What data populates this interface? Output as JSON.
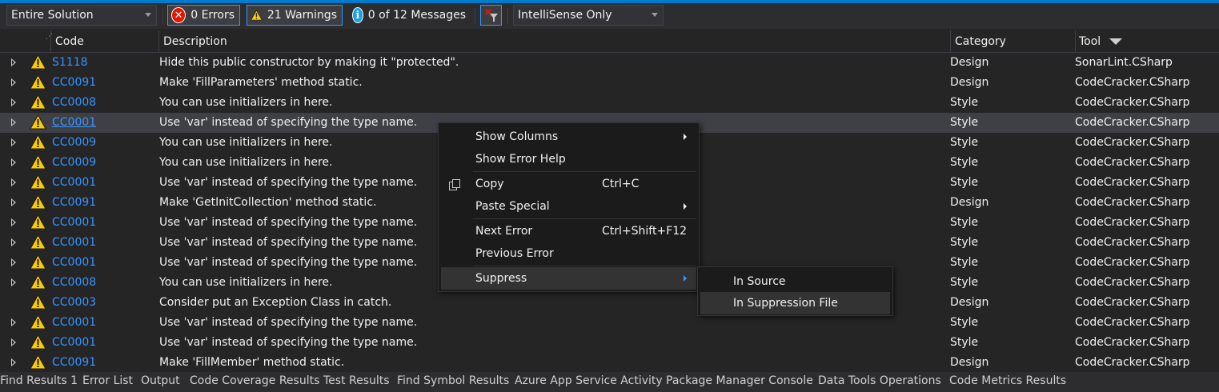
{
  "toolbar": {
    "scope_value": "Entire Solution",
    "errors_label": "0 Errors",
    "warnings_label": "21 Warnings",
    "messages_label": "0 of 12 Messages",
    "build_filter_value": "IntelliSense Only"
  },
  "columns": {
    "code": "Code",
    "description": "Description",
    "category": "Category",
    "tool": "Tool"
  },
  "rows": [
    {
      "code": "S1118",
      "description": "Hide this public constructor by making it \"protected\".",
      "category": "Design",
      "tool": "SonarLint.CSharp"
    },
    {
      "code": "CC0091",
      "description": "Make 'FillParameters' method static.",
      "category": "Design",
      "tool": "CodeCracker.CSharp"
    },
    {
      "code": "CC0008",
      "description": "You can use initializers in here.",
      "category": "Style",
      "tool": "CodeCracker.CSharp"
    },
    {
      "code": "CC0001",
      "description": "Use 'var' instead of specifying the type name.",
      "category": "Style",
      "tool": "CodeCracker.CSharp"
    },
    {
      "code": "CC0009",
      "description": "You can use initializers in here.",
      "category": "Style",
      "tool": "CodeCracker.CSharp"
    },
    {
      "code": "CC0009",
      "description": "You can use initializers in here.",
      "category": "Style",
      "tool": "CodeCracker.CSharp"
    },
    {
      "code": "CC0001",
      "description": "Use 'var' instead of specifying the type name.",
      "category": "Style",
      "tool": "CodeCracker.CSharp"
    },
    {
      "code": "CC0091",
      "description": "Make 'GetInitCollection' method static.",
      "category": "Design",
      "tool": "CodeCracker.CSharp"
    },
    {
      "code": "CC0001",
      "description": "Use 'var' instead of specifying the type name.",
      "category": "Style",
      "tool": "CodeCracker.CSharp"
    },
    {
      "code": "CC0001",
      "description": "Use 'var' instead of specifying the type name.",
      "category": "Style",
      "tool": "CodeCracker.CSharp"
    },
    {
      "code": "CC0001",
      "description": "Use 'var' instead of specifying the type name.",
      "category": "Style",
      "tool": "CodeCracker.CSharp"
    },
    {
      "code": "CC0008",
      "description": "You can use initializers in here.",
      "category": "Style",
      "tool": "CodeCracker.CSharp"
    },
    {
      "code": "CC0003",
      "description": "Consider put an Exception Class in catch.",
      "category": "Design",
      "tool": "CodeCracker.CSharp"
    },
    {
      "code": "CC0001",
      "description": "Use 'var' instead of specifying the type name.",
      "category": "Style",
      "tool": "CodeCracker.CSharp"
    },
    {
      "code": "CC0001",
      "description": "Use 'var' instead of specifying the type name.",
      "category": "Style",
      "tool": "CodeCracker.CSharp"
    },
    {
      "code": "CC0091",
      "description": "Make 'FillMember' method static.",
      "category": "Design",
      "tool": "CodeCracker.CSharp"
    }
  ],
  "context_menu": {
    "show_columns": "Show Columns",
    "show_error_help": "Show Error Help",
    "copy": "Copy",
    "copy_shortcut": "Ctrl+C",
    "paste_special": "Paste Special",
    "next_error": "Next Error",
    "next_error_shortcut": "Ctrl+Shift+F12",
    "previous_error": "Previous Error",
    "suppress": "Suppress"
  },
  "suppress_submenu": {
    "in_source": "In Source",
    "in_suppression_file": "In Suppression File"
  },
  "bottom_tabs": [
    "Find Results 1",
    "Error List",
    "Output",
    "Code Coverage Results",
    "Test Results",
    "Find Symbol Results",
    "Azure App Service Activity",
    "Package Manager Console",
    "Data Tools Operations",
    "Code Metrics Results"
  ],
  "colors": {
    "accent": "#007acc",
    "link": "#3794ff",
    "warning": "#ffcc00",
    "error": "#e51400",
    "info": "#1ba1e2"
  }
}
